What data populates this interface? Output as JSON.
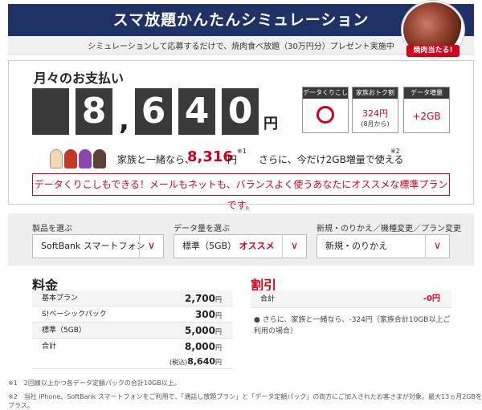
{
  "header": {
    "title": "スマ放題かんたんシミュレーション"
  },
  "promo": {
    "text": "シミュレーションして応募するだけで、焼肉食べ放題（30万円分）プレゼント実施中",
    "badge": "焼肉当たる!"
  },
  "payment": {
    "label": "月々のお支払い",
    "digits": [
      "8",
      "6",
      "4",
      "0"
    ],
    "comma": ",",
    "yen": "円"
  },
  "options": [
    {
      "head": "データくりこし",
      "value": "○"
    },
    {
      "head": "家族おトク割",
      "value": "324円",
      "sub": "(8月から)"
    },
    {
      "head": "データ増量",
      "value": "+2GB"
    }
  ],
  "family": {
    "text1": "家族と一緒なら、",
    "price": "8,316",
    "yen": "円",
    "note1": "※1",
    "text2": "さらに、今だけ2GB増量で使える",
    "note2": "※2"
  },
  "recommend": "データくりこしもできる！メールもネットも、バランスよく使うあなたにオススメな標準プランです。",
  "selectors": [
    {
      "label": "製品を選ぶ",
      "value": "SoftBank スマートフォン",
      "highlight": ""
    },
    {
      "label": "データ量を選ぶ",
      "value": "標準（5GB）",
      "highlight": "オススメ"
    },
    {
      "label": "新規・のりかえ／機種変更／プラン変更",
      "value": "新規・のりかえ",
      "highlight": ""
    }
  ],
  "fees": {
    "title": "料金",
    "rows": [
      {
        "name": "基本プラン",
        "amount": "2,700",
        "unit": "円"
      },
      {
        "name": "S!ベーシックパック",
        "amount": "300",
        "unit": "円"
      },
      {
        "name": "標準（5GB）",
        "amount": "5,000",
        "unit": "円"
      }
    ],
    "total": {
      "name": "合計",
      "amount": "8,000",
      "unit": "円",
      "tax_label": "(税込)",
      "tax_amount": "8,640",
      "tax_unit": "円"
    }
  },
  "discount": {
    "title": "割引",
    "row": {
      "name": "合計",
      "amount": "-0円"
    },
    "note": "● さらに、家族と一緒なら、-324円（家族合計10GB以上ご利用の場合）"
  },
  "footnotes": [
    "※1　2回線以上かつ各データ定額パックの合計10GB以上。",
    "※2　当社 iPhone、SoftBank スマートフォンをご利用で、「通話し放題プラン」と「データ定額パック」の両方にご加入されたお客さまが対象。最大13ヵ月2GBをプラス。"
  ],
  "colors": {
    "header": "#1e3266",
    "accent": "#d0021b",
    "digit_bg": "#3a3a3a"
  },
  "icons": {
    "dropdown": "chevron-down-icon",
    "family": "family-icon"
  }
}
